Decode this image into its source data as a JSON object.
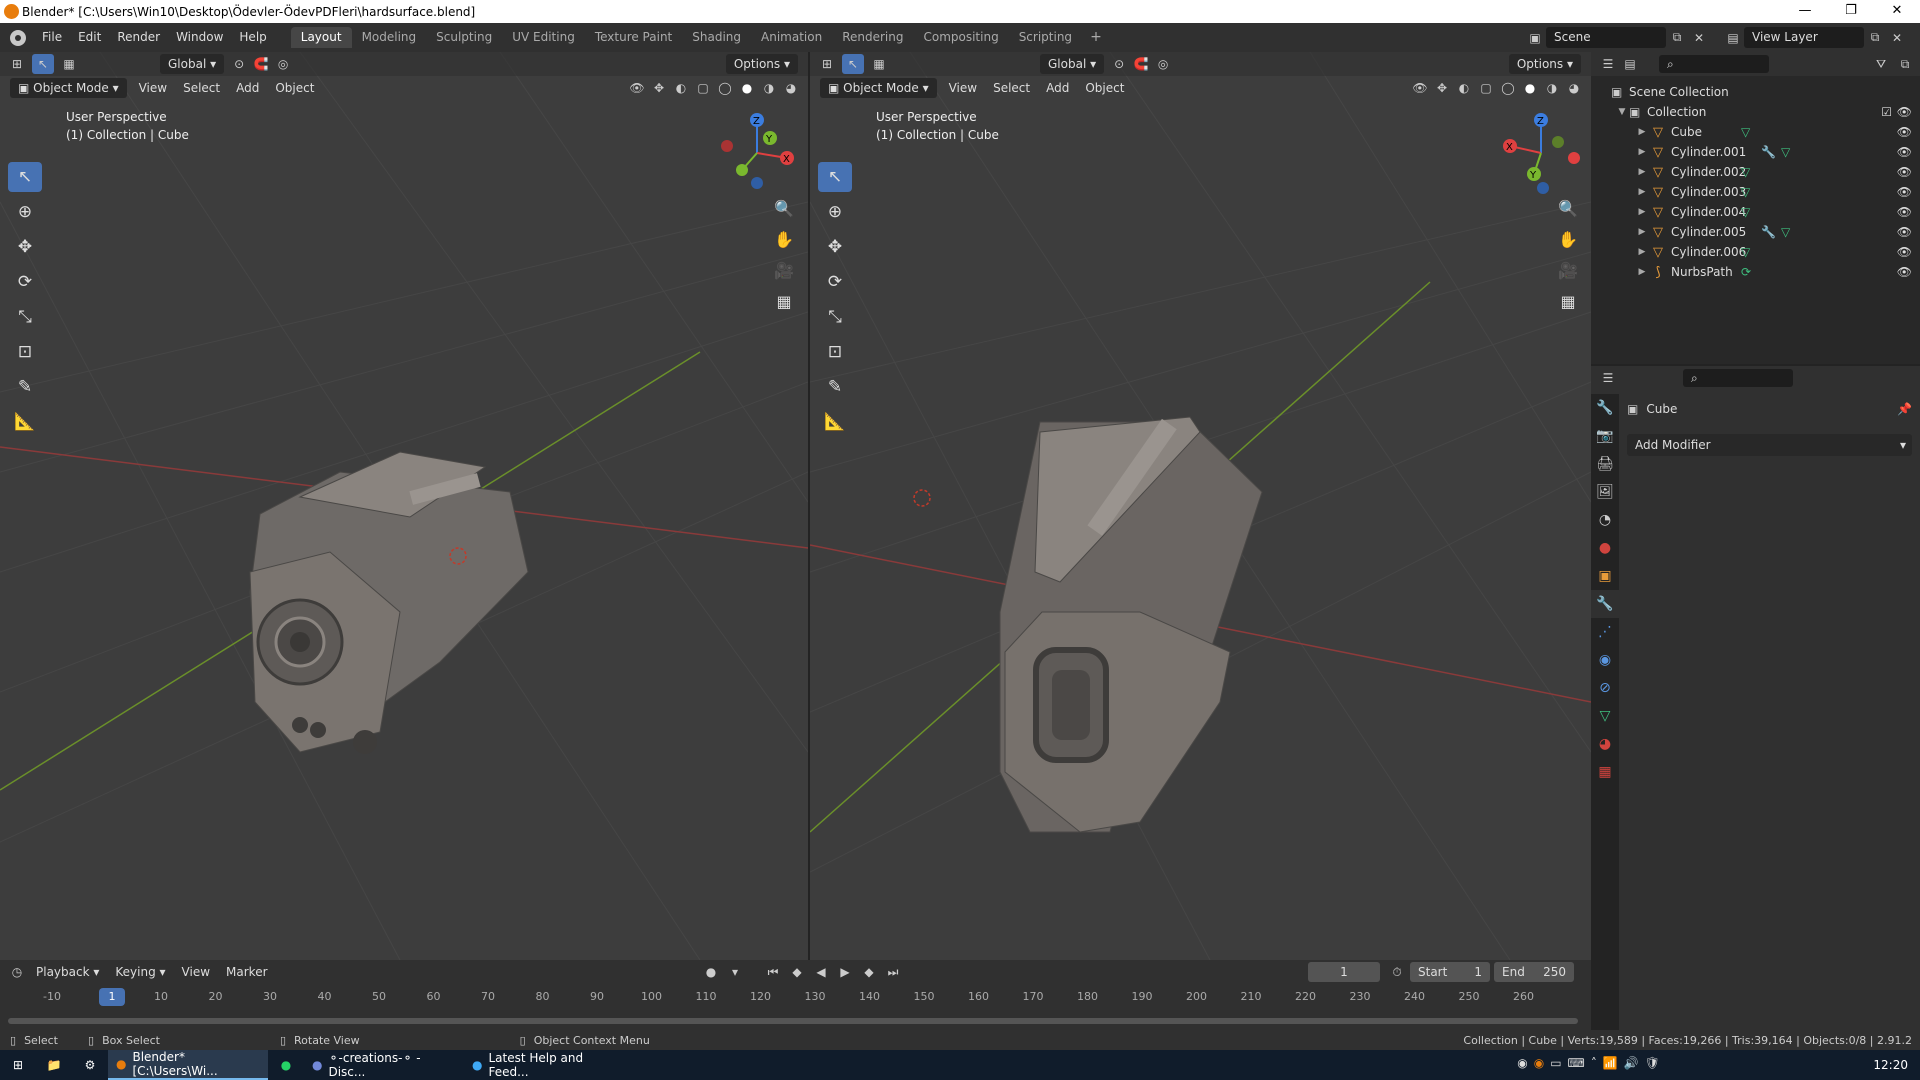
{
  "window": {
    "title": "Blender* [C:\\Users\\Win10\\Desktop\\Ödevler-ÖdevPDFleri\\hardsurface.blend]",
    "minimize": "—",
    "restore": "❐",
    "close": "✕"
  },
  "menu": [
    "File",
    "Edit",
    "Render",
    "Window",
    "Help"
  ],
  "workspaces": [
    "Layout",
    "Modeling",
    "Sculpting",
    "UV Editing",
    "Texture Paint",
    "Shading",
    "Animation",
    "Rendering",
    "Compositing",
    "Scripting"
  ],
  "scene": {
    "label": "Scene",
    "view_layer": "View Layer"
  },
  "viewport_header": {
    "orientation": "Global",
    "options": "Options",
    "mode": "Object Mode",
    "menus": [
      "View",
      "Select",
      "Add",
      "Object"
    ]
  },
  "viewport_left": {
    "perspective": "User Perspective",
    "collection": "(1) Collection | Cube"
  },
  "viewport_right": {
    "perspective": "User Perspective",
    "collection": "(1) Collection | Cube"
  },
  "gizmo": {
    "x": "X",
    "y": "Y",
    "z": "Z"
  },
  "outliner": {
    "root": "Scene Collection",
    "collection": "Collection",
    "items": [
      {
        "name": "Cube",
        "modifier": false
      },
      {
        "name": "Cylinder.001",
        "modifier": true
      },
      {
        "name": "Cylinder.002",
        "modifier": false
      },
      {
        "name": "Cylinder.003",
        "modifier": false
      },
      {
        "name": "Cylinder.004",
        "modifier": false
      },
      {
        "name": "Cylinder.005",
        "modifier": true
      },
      {
        "name": "Cylinder.006",
        "modifier": false
      },
      {
        "name": "NurbsPath",
        "modifier": false
      }
    ]
  },
  "properties": {
    "object": "Cube",
    "add_modifier": "Add Modifier"
  },
  "timeline": {
    "menus": [
      "Playback",
      "Keying",
      "View",
      "Marker"
    ],
    "current": "1",
    "start_label": "Start",
    "start": "1",
    "end_label": "End",
    "end": "250",
    "ticks": [
      "-10",
      "1",
      "10",
      "20",
      "30",
      "40",
      "50",
      "60",
      "70",
      "80",
      "90",
      "100",
      "110",
      "120",
      "130",
      "140",
      "150",
      "160",
      "170",
      "180",
      "190",
      "200",
      "210",
      "220",
      "230",
      "240",
      "250",
      "260"
    ]
  },
  "status": {
    "select": "Select",
    "box": "Box Select",
    "rotate": "Rotate View",
    "context": "Object Context Menu",
    "stats": "Collection | Cube | Verts:19,589 | Faces:19,266 | Tris:39,164 | Objects:0/8 | 2.91.2"
  },
  "taskbar": {
    "items": [
      "Blender* [C:\\Users\\Wi...",
      "",
      "⚬-creations-⚬ - Disc...",
      "Latest Help and Feed..."
    ],
    "time": "12:20"
  }
}
